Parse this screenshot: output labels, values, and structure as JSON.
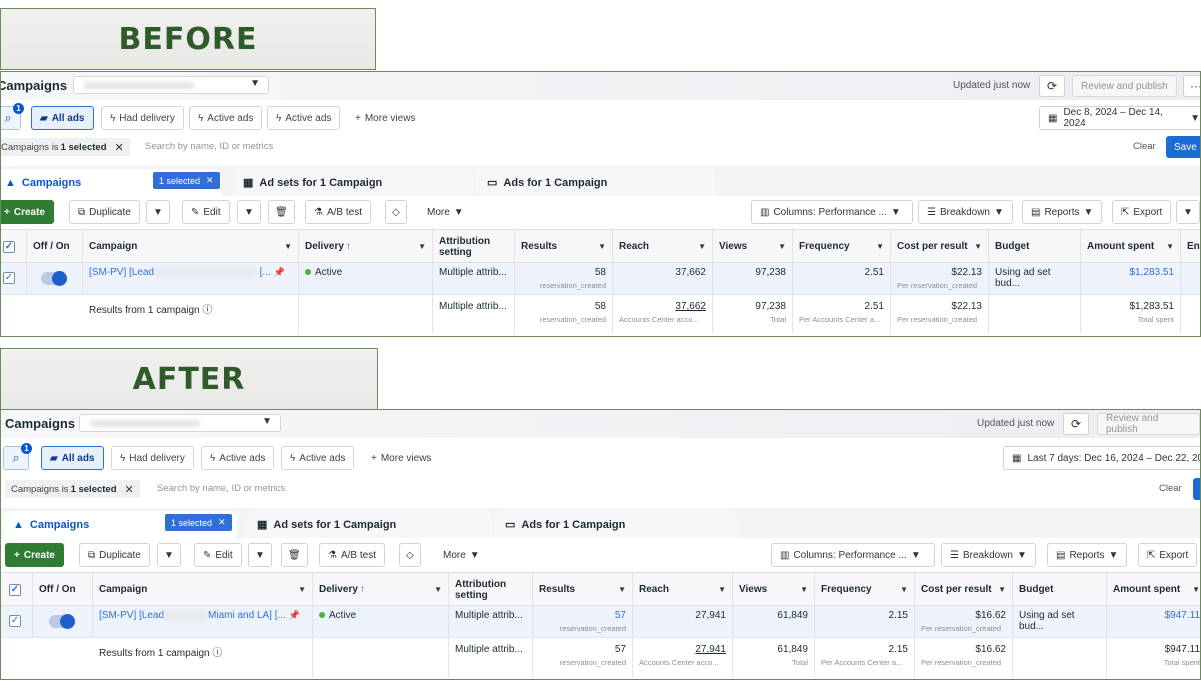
{
  "labels": {
    "before": "BEFORE",
    "after": "AFTER"
  },
  "common": {
    "title": "Campaigns",
    "updated": "Updated just now",
    "review_publish": "Review and publish",
    "more": "···",
    "search_badge": "1",
    "views": {
      "all_ads": "All ads",
      "had_delivery": "Had delivery",
      "active_ads_1": "Active ads",
      "active_ads_2": "Active ads",
      "more_views": "More views"
    },
    "filter": {
      "chip_prefix": "Campaigns is ",
      "chip_bold": "1 selected",
      "search_placeholder": "Search by name, ID or metrics",
      "clear": "Clear",
      "save": "Save"
    },
    "tabs": {
      "campaigns": "Campaigns",
      "selected": "1 selected",
      "adsets": "Ad sets for 1 Campaign",
      "ads": "Ads for 1 Campaign"
    },
    "toolbar": {
      "create": "Create",
      "duplicate": "Duplicate",
      "edit": "Edit",
      "ab_test": "A/B test",
      "more": "More",
      "columns": "Columns: Performance ...",
      "breakdown": "Breakdown",
      "reports": "Reports",
      "export": "Export"
    },
    "headers": {
      "offon": "Off / On",
      "campaign": "Campaign",
      "delivery": "Delivery",
      "attribution": "Attribution setting",
      "results": "Results",
      "reach": "Reach",
      "views": "Views",
      "frequency": "Frequency",
      "cpr": "Cost per result",
      "budget": "Budget",
      "amount": "Amount spent",
      "ends": "Ends"
    },
    "row": {
      "campaign_prefix": "[SM-PV] [Lead",
      "delivery": "Active",
      "attribution": "Multiple attrib...",
      "results_sub": "reservation_created",
      "cpr_sub": "Per reservation_created",
      "budget": "Using ad set bud..."
    },
    "summary": {
      "label": "Results from 1 campaign",
      "attribution": "Multiple attrib...",
      "results_sub": "reservation_created",
      "reach_sub": "Accounts Center acco...",
      "views_sub": "Total",
      "freq_sub": "Per Accounts Center a...",
      "cpr_sub": "Per reservation_created",
      "amount_sub": "Total spent"
    }
  },
  "before": {
    "date_range": "Dec 8, 2024 – Dec 14, 2024",
    "row": {
      "campaign_suffix": "[...",
      "results": "58",
      "reach": "37,662",
      "views": "97,238",
      "frequency": "2.51",
      "cpr": "$22.13",
      "amount": "$1,283.51"
    },
    "summary": {
      "results": "58",
      "reach": "37,662",
      "views": "97,238",
      "frequency": "2.51",
      "cpr": "$22.13",
      "amount": "$1,283.51"
    }
  },
  "after": {
    "date_range": "Last 7 days: Dec 16, 2024 – Dec 22, 20",
    "row": {
      "campaign_suffix": "Miami and LA] [...",
      "results": "57",
      "reach": "27,941",
      "views": "61,849",
      "frequency": "2.15",
      "cpr": "$16.62",
      "amount": "$947.11"
    },
    "summary": {
      "results": "57",
      "reach": "27,941",
      "views": "61,849",
      "frequency": "2.15",
      "cpr": "$16.62",
      "amount": "$947.11"
    }
  }
}
